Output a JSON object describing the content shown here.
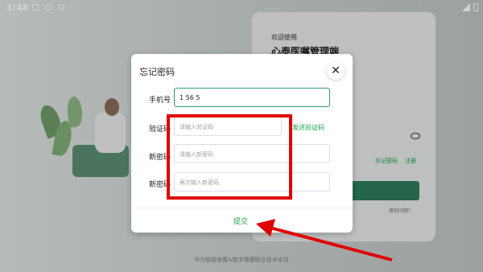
{
  "status_bar": {
    "time": "1:48"
  },
  "background": {
    "welcome": "欢迎使用",
    "app_name": "心泰医嘱管理端",
    "forgot_link": "忘记密码",
    "register_link": "注册",
    "problem_text": "遇到问题?",
    "footer": "华为智能穿戴&数字健康联合技术支持"
  },
  "dialog": {
    "title": "忘记密码",
    "close_symbol": "✕",
    "phone": {
      "label": "手机号",
      "value": "1     56       5"
    },
    "code": {
      "label": "验证码",
      "placeholder": "请输入验证码",
      "send_label": "发送验证码"
    },
    "new_password": {
      "label": "新密码",
      "placeholder": "请输入新密码"
    },
    "confirm_password": {
      "label": "新密码",
      "placeholder": "再次输入新密码"
    },
    "submit_label": "提交"
  },
  "annotation": {
    "color": "#e00000"
  },
  "colors": {
    "accent": "#16a34a",
    "brand_button": "#2e7d5b"
  }
}
